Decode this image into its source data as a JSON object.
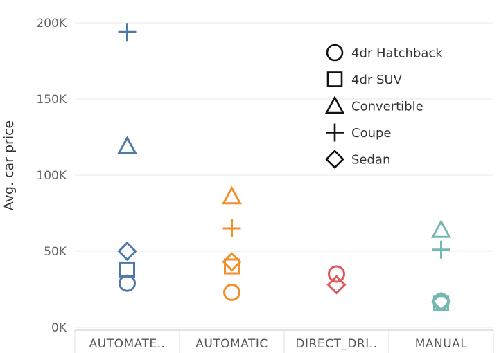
{
  "chart_data": {
    "type": "scatter",
    "title": "",
    "xlabel": "",
    "ylabel": "Avg. car price",
    "ylim": [
      0,
      200000
    ],
    "yticks": [
      0,
      50000,
      100000,
      150000,
      200000
    ],
    "ytick_labels": [
      "0K",
      "50K",
      "100K",
      "150K",
      "200K"
    ],
    "categories": [
      "AUTOMATE..",
      "AUTOMATIC",
      "DIRECT_DRI..",
      "MANUAL"
    ],
    "category_colors": [
      "#4e79a7",
      "#f28e2b",
      "#e15759",
      "#76b7b2"
    ],
    "grid": "horizontal",
    "legend_position": "top-right",
    "shapes": [
      {
        "name": "4dr Hatchback",
        "marker": "circle"
      },
      {
        "name": "4dr SUV",
        "marker": "square"
      },
      {
        "name": "Convertible",
        "marker": "triangle"
      },
      {
        "name": "Coupe",
        "marker": "plus"
      },
      {
        "name": "Sedan",
        "marker": "diamond"
      }
    ],
    "points": [
      {
        "category": "AUTOMATE..",
        "shape": "4dr Hatchback",
        "y": 29000
      },
      {
        "category": "AUTOMATE..",
        "shape": "4dr SUV",
        "y": 38000
      },
      {
        "category": "AUTOMATE..",
        "shape": "Convertible",
        "y": 119000
      },
      {
        "category": "AUTOMATE..",
        "shape": "Coupe",
        "y": 194000
      },
      {
        "category": "AUTOMATE..",
        "shape": "Sedan",
        "y": 50000
      },
      {
        "category": "AUTOMATIC",
        "shape": "4dr Hatchback",
        "y": 23000
      },
      {
        "category": "AUTOMATIC",
        "shape": "4dr SUV",
        "y": 40000
      },
      {
        "category": "AUTOMATIC",
        "shape": "Convertible",
        "y": 86000
      },
      {
        "category": "AUTOMATIC",
        "shape": "Coupe",
        "y": 65000
      },
      {
        "category": "AUTOMATIC",
        "shape": "Sedan",
        "y": 43000
      },
      {
        "category": "DIRECT_DRI..",
        "shape": "4dr Hatchback",
        "y": 35000
      },
      {
        "category": "DIRECT_DRI..",
        "shape": "Sedan",
        "y": 28000
      },
      {
        "category": "MANUAL",
        "shape": "4dr Hatchback",
        "y": 17000
      },
      {
        "category": "MANUAL",
        "shape": "4dr SUV",
        "y": 16000
      },
      {
        "category": "MANUAL",
        "shape": "Convertible",
        "y": 64000
      },
      {
        "category": "MANUAL",
        "shape": "Coupe",
        "y": 51000
      },
      {
        "category": "MANUAL",
        "shape": "Sedan",
        "y": 17000
      }
    ]
  }
}
